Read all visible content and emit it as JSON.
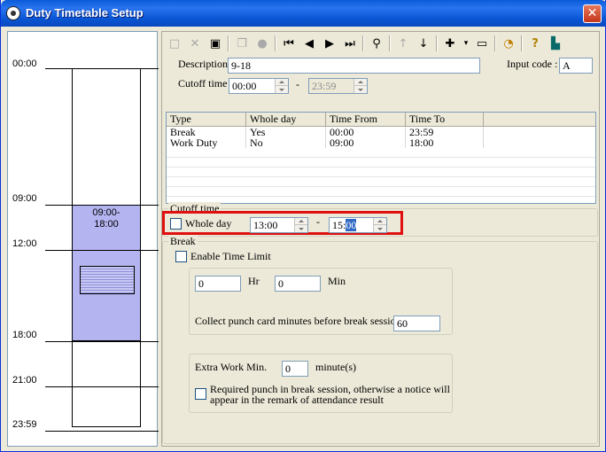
{
  "window": {
    "title": "Duty Timetable Setup",
    "close_glyph": "✕"
  },
  "timeline": {
    "labels": [
      "00:00",
      "09:00",
      "12:00",
      "18:00",
      "21:00",
      "23:59"
    ],
    "duty_label": "09:00-\n18:00"
  },
  "toolbar": {
    "icons": [
      "new-icon",
      "delete-icon",
      "save-icon",
      "copy-icon",
      "record-icon",
      "first-icon",
      "prev-icon",
      "next-icon",
      "last-icon",
      "find-icon",
      "up-icon",
      "down-icon",
      "add-icon",
      "remove-icon",
      "clock-icon",
      "help-icon",
      "exit-icon"
    ]
  },
  "form": {
    "description_label": "Description",
    "description_value": "9-18",
    "input_code_label": "Input code :",
    "input_code_value": "A",
    "cutoff_label": "Cutoff time",
    "cutoff_from": "00:00",
    "cutoff_dash": "-",
    "cutoff_to": "23:59"
  },
  "grid": {
    "headers": [
      "Type",
      "Whole day",
      "Time From",
      "Time To"
    ],
    "rows": [
      [
        "Break",
        "Yes",
        "00:00",
        "23:59"
      ],
      [
        "Work Duty",
        "No",
        "09:00",
        "18:00"
      ]
    ]
  },
  "cutoff_box": {
    "title": "Cutoff time",
    "whole_day_label": "Whole day",
    "from": "13:00",
    "dash": "-",
    "to_hour": "15:",
    "to_min": "00"
  },
  "break_box": {
    "title": "Break",
    "enable_label": "Enable Time Limit",
    "hr_value": "0",
    "hr_label": "Hr",
    "min_value": "0",
    "min_label": "Min",
    "collect_label": "Collect punch card minutes before break session :",
    "collect_value": "60",
    "extra_label": "Extra Work Min.",
    "extra_value": "0",
    "extra_unit": "minute(s)",
    "required_label_1": "Required punch in break session, otherwise a notice will",
    "required_label_2": "appear in the remark of attendance result"
  }
}
